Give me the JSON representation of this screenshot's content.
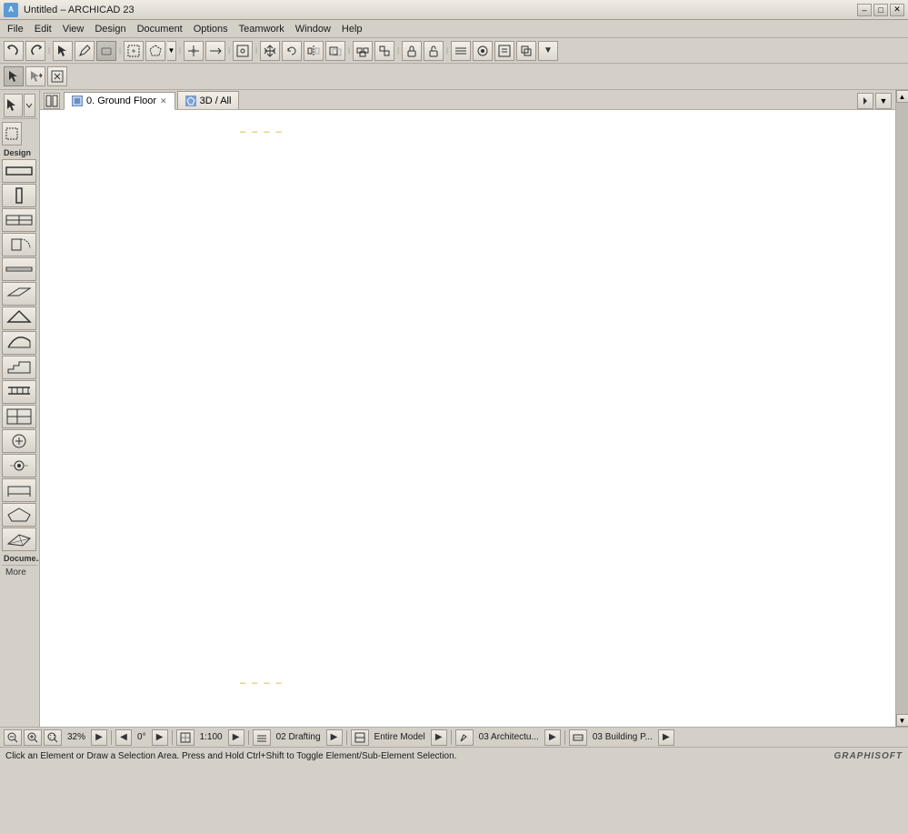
{
  "titlebar": {
    "title": "Untitled – ARCHICAD 23",
    "icon_text": "A",
    "btn_minimize": "–",
    "btn_restore": "□",
    "btn_close": "✕",
    "btn_submenu": "▼"
  },
  "menubar": {
    "items": [
      "File",
      "Edit",
      "View",
      "Design",
      "Document",
      "Options",
      "Teamwork",
      "Window",
      "Help"
    ]
  },
  "toolbar1": {
    "tools": [
      {
        "id": "undo",
        "icon": "↩",
        "label": "Undo"
      },
      {
        "id": "redo",
        "icon": "↪",
        "label": "Redo"
      },
      {
        "id": "sep1"
      },
      {
        "id": "arrow",
        "icon": "↖",
        "label": "Arrow"
      },
      {
        "id": "pencil",
        "icon": "✏",
        "label": "Pencil"
      },
      {
        "id": "eraser",
        "icon": "◻",
        "label": "Eraser"
      },
      {
        "id": "sep2"
      },
      {
        "id": "select-rect",
        "icon": "⬚",
        "label": "Select Rectangle"
      },
      {
        "id": "select-poly",
        "icon": "⬟",
        "label": "Select Polygon"
      },
      {
        "id": "sep3"
      },
      {
        "id": "trim",
        "icon": "+",
        "label": "Trim"
      },
      {
        "id": "extend",
        "icon": "⊹",
        "label": "Extend"
      },
      {
        "id": "sep4"
      },
      {
        "id": "snap",
        "icon": "⊞",
        "label": "Snap"
      },
      {
        "id": "sep5"
      },
      {
        "id": "move",
        "icon": "✥",
        "label": "Move"
      },
      {
        "id": "rotate",
        "icon": "↻",
        "label": "Rotate"
      },
      {
        "id": "mirror",
        "icon": "⇄",
        "label": "Mirror"
      },
      {
        "id": "offset",
        "icon": "⇒",
        "label": "Offset"
      },
      {
        "id": "sep6"
      },
      {
        "id": "group",
        "icon": "▣",
        "label": "Group"
      },
      {
        "id": "ungroup",
        "icon": "◫",
        "label": "Ungroup"
      },
      {
        "id": "sep7"
      },
      {
        "id": "lock",
        "icon": "🔒",
        "label": "Lock"
      },
      {
        "id": "unlock",
        "icon": "🔓",
        "label": "Unlock"
      },
      {
        "id": "sep8"
      },
      {
        "id": "layer",
        "icon": "≡",
        "label": "Layers"
      },
      {
        "id": "more",
        "icon": "▼",
        "label": "More"
      }
    ]
  },
  "toolbar2": {
    "tools": [
      {
        "id": "select2",
        "icon": "↖",
        "label": "Select"
      },
      {
        "id": "arrow-r",
        "icon": "→",
        "label": "Arrow Right"
      },
      {
        "id": "magic",
        "icon": "⬟",
        "label": "Magic Wand"
      },
      {
        "id": "sep1"
      },
      {
        "id": "sep2"
      }
    ]
  },
  "left_toolbar": {
    "section_design": "Design",
    "section_document": "Docume...",
    "more_label": "More",
    "tools": [
      {
        "id": "wall",
        "icon": "▬",
        "label": "Wall"
      },
      {
        "id": "column",
        "icon": "▐",
        "label": "Column"
      },
      {
        "id": "window",
        "icon": "⊞",
        "label": "Window"
      },
      {
        "id": "door",
        "icon": "⊡",
        "label": "Door"
      },
      {
        "id": "beam",
        "icon": "▭",
        "label": "Beam"
      },
      {
        "id": "slab",
        "icon": "▱",
        "label": "Slab"
      },
      {
        "id": "roof",
        "icon": "▽",
        "label": "Roof"
      },
      {
        "id": "shell",
        "icon": "⟨",
        "label": "Shell"
      },
      {
        "id": "stair",
        "icon": "⊟",
        "label": "Stair"
      },
      {
        "id": "railing",
        "icon": "⊠",
        "label": "Railing"
      },
      {
        "id": "curtain-wall",
        "icon": "⊞",
        "label": "Curtain Wall"
      },
      {
        "id": "object",
        "icon": "◎",
        "label": "Object"
      },
      {
        "id": "lamp",
        "icon": "⊙",
        "label": "Lamp"
      },
      {
        "id": "furniture",
        "icon": "⊕",
        "label": "Furniture"
      },
      {
        "id": "morph",
        "icon": "◇",
        "label": "Morph"
      },
      {
        "id": "mesh",
        "icon": "⊹",
        "label": "Mesh"
      }
    ]
  },
  "tabs": [
    {
      "id": "ground-floor",
      "label": "0. Ground Floor",
      "active": true,
      "has_close": true
    },
    {
      "id": "3d-view",
      "label": "3D / All",
      "active": false,
      "has_close": false
    }
  ],
  "canvas": {
    "background": "white",
    "marker_top": "– – – –",
    "marker_bottom": "– – – –"
  },
  "bottom_toolbar": {
    "zoom_out": "–",
    "zoom_in": "+",
    "zoom_level": "32%",
    "zoom_dropdown": "▶",
    "prev_view": "◀",
    "angle": "0°",
    "next_angle": "▶",
    "scale_icon": "⊡",
    "scale": "1:100",
    "scale_next": "▶",
    "layer_icon": "◫",
    "layer_name": "02 Drafting",
    "layer_next": "▶",
    "filter_icon": "⊞",
    "filter_name": "Entire Model",
    "filter_next": "▶",
    "pen_icon": "✏",
    "pen_name": "03 Architectu...",
    "pen_next": "▶",
    "pen2_icon": "⊟",
    "pen2_name": "03 Building P...",
    "pen2_next": "▶"
  },
  "status_bar": {
    "message": "Click an Element or Draw a Selection Area. Press and Hold Ctrl+Shift to Toggle Element/Sub-Element Selection.",
    "branding": "GRAPHISOFT"
  }
}
